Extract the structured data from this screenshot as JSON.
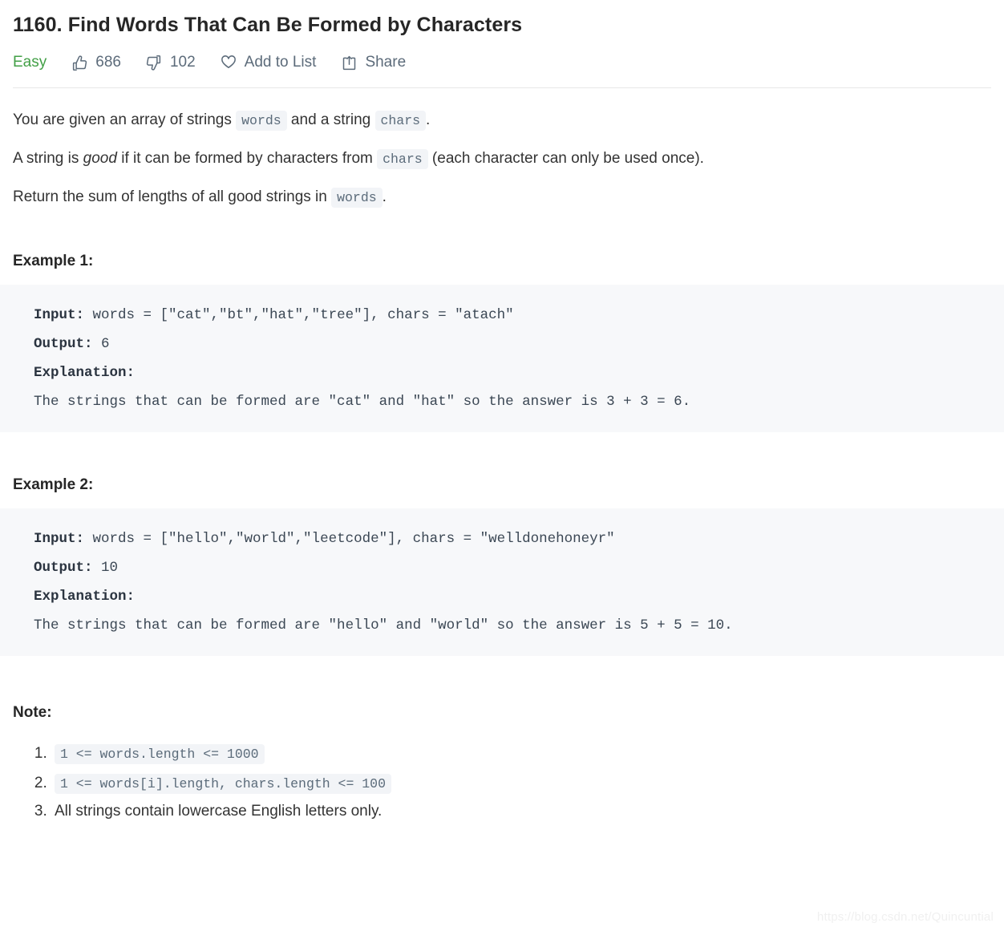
{
  "problem": {
    "title": "1160. Find Words That Can Be Formed by Characters",
    "difficulty": "Easy",
    "likes": "686",
    "dislikes": "102",
    "add_to_list_label": "Add to List",
    "share_label": "Share",
    "icons": {
      "like": "thumbs-up-icon",
      "dislike": "thumbs-down-icon",
      "favorite": "heart-icon",
      "share": "share-icon"
    }
  },
  "description": {
    "p1_a": "You are given an array of strings ",
    "p1_code1": "words",
    "p1_b": " and a string ",
    "p1_code2": "chars",
    "p1_c": ".",
    "p2_a": "A string is ",
    "p2_em": "good",
    "p2_b": " if it can be formed by characters from ",
    "p2_code": "chars",
    "p2_c": " (each character can only be used once).",
    "p3_a": "Return the sum of lengths of all good strings in ",
    "p3_code": "words",
    "p3_b": "."
  },
  "examples": [
    {
      "heading": "Example 1:",
      "input_label": "Input:",
      "input_value": " words = [\"cat\",\"bt\",\"hat\",\"tree\"], chars = \"atach\"",
      "output_label": "Output:",
      "output_value": " 6",
      "explanation_label": "Explanation:",
      "explanation_text": "The strings that can be formed are \"cat\" and \"hat\" so the answer is 3 + 3 = 6."
    },
    {
      "heading": "Example 2:",
      "input_label": "Input:",
      "input_value": " words = [\"hello\",\"world\",\"leetcode\"], chars = \"welldonehoneyr\"",
      "output_label": "Output:",
      "output_value": " 10",
      "explanation_label": "Explanation:",
      "explanation_text": "The strings that can be formed are \"hello\" and \"world\" so the answer is 5 + 5 = 10."
    }
  ],
  "note": {
    "heading": "Note:",
    "items": [
      {
        "code": "1 <= words.length <= 1000"
      },
      {
        "code": "1 <= words[i].length, chars.length <= 100"
      },
      {
        "text": "All strings contain lowercase English letters only."
      }
    ]
  },
  "watermark": "https://blog.csdn.net/Quincuntial"
}
